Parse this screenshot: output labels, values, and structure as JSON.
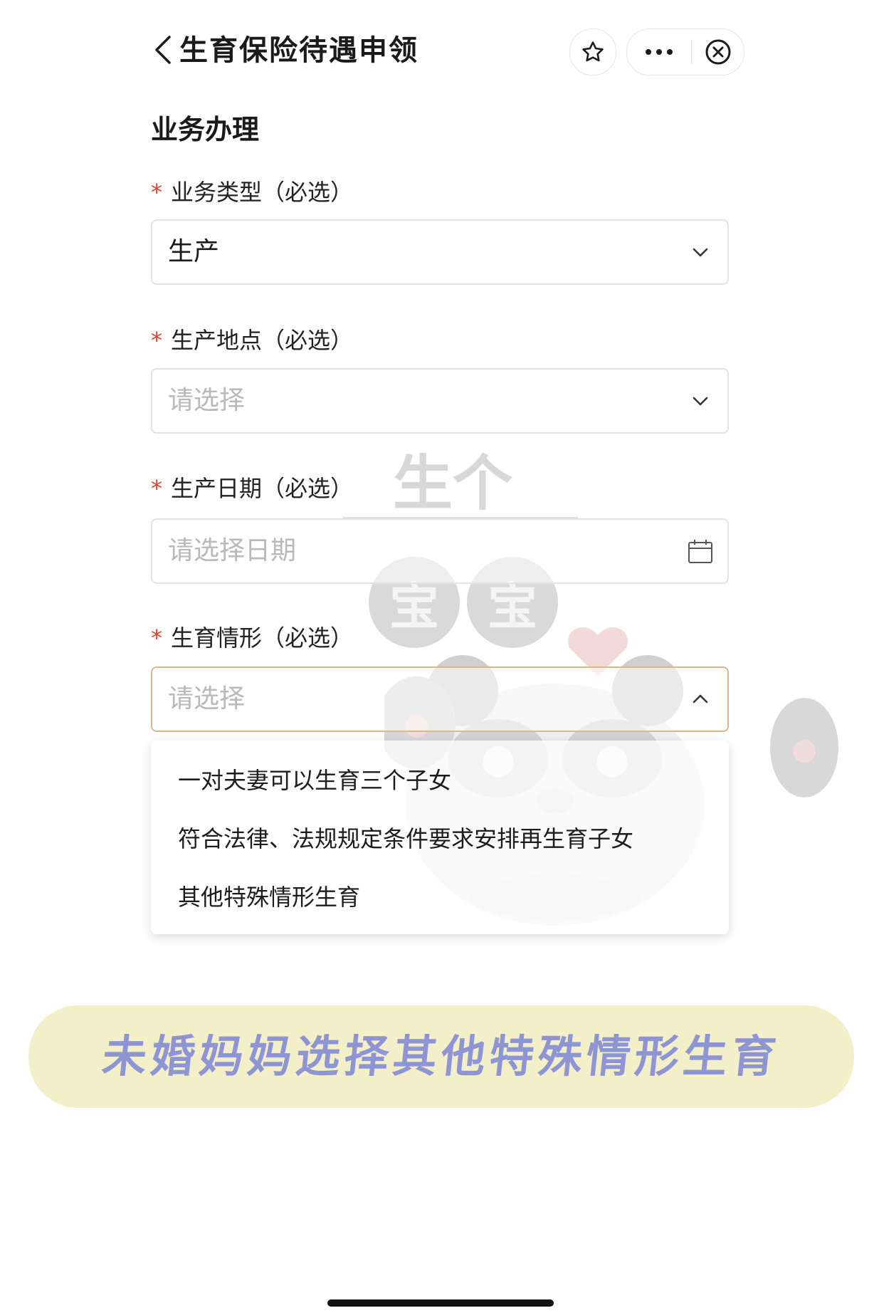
{
  "header": {
    "title": "生育保险待遇申领"
  },
  "section_title": "业务办理",
  "required_mark": "*",
  "fields": [
    {
      "label": "业务类型（必选）",
      "value": "生产",
      "placeholder": ""
    },
    {
      "label": "生产地点（必选）",
      "value": "",
      "placeholder": "请选择"
    },
    {
      "label": "生产日期（必选）",
      "value": "",
      "placeholder": "请选择日期"
    },
    {
      "label": "生育情形（必选）",
      "value": "",
      "placeholder": "请选择"
    }
  ],
  "dropdown": {
    "options": [
      "一对夫妻可以生育三个子女",
      "符合法律、法规规定条件要求安排再生育子女",
      "其他特殊情形生育"
    ]
  },
  "watermark": {
    "line1": "生个",
    "line2a": "宝",
    "line2b": "宝"
  },
  "banner_text": "未婚妈妈选择其他特殊情形生育",
  "colors": {
    "required": "#e6432a",
    "placeholder": "#b9b9b9",
    "banner_bg": "#f3efc8",
    "banner_text": "#8e95d4",
    "active_border": "#d9b98a"
  }
}
